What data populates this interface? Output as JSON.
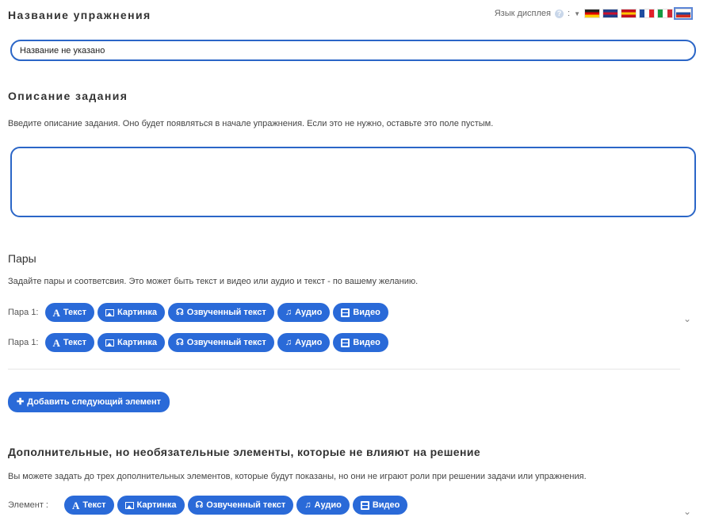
{
  "header": {
    "exercise_title_label": "Название упражнения",
    "display_language_label": "Язык дисплея",
    "help_glyph": "?",
    "separator": ":",
    "flags": [
      {
        "name": "flag-german",
        "stripes": [
          "#222222",
          "#dd0000",
          "#ffce00"
        ],
        "dir": "h"
      },
      {
        "name": "flag-uk",
        "stripes": [
          "#1f3f8a",
          "#c8102e",
          "#1f3f8a"
        ],
        "dir": "h"
      },
      {
        "name": "flag-spain",
        "stripes": [
          "#c60b1e",
          "#ffc400",
          "#c60b1e"
        ],
        "dir": "h"
      },
      {
        "name": "flag-france",
        "stripes": [
          "#1f4da0",
          "#ffffff",
          "#e1202a"
        ],
        "dir": "v"
      },
      {
        "name": "flag-italy",
        "stripes": [
          "#159a42",
          "#ffffff",
          "#cf2734"
        ],
        "dir": "v"
      },
      {
        "name": "flag-russia",
        "stripes": [
          "#ffffff",
          "#1f4da0",
          "#d52b1e"
        ],
        "dir": "h"
      }
    ]
  },
  "title_input": {
    "value": "Название не указано"
  },
  "description": {
    "heading": "Описание задания",
    "hint": "Введите описание задания. Оно будет появляться в начале упражнения. Если это не нужно, оставьте это поле пустым.",
    "value": ""
  },
  "pairs": {
    "heading": "Пары",
    "hint": "Задайте пары и соответсвия. Это может быть текст и видео или аудио и текст - по вашему желанию.",
    "rows": [
      {
        "label": "Пара 1:"
      },
      {
        "label": "Пара 1:"
      }
    ],
    "add_button": "Добавить следующий элемент"
  },
  "type_buttons": {
    "text": "Текст",
    "image": "Картинка",
    "spoken_text": "Озвученный текст",
    "audio": "Аудио",
    "video": "Видео"
  },
  "extra": {
    "heading": "Дополнительные, но необязательные элементы, которые не влияют на решение",
    "hint": "Вы можете задать до трех дополнительных элементов, которые будут показаны, но они не играют роли при решении задачи или упражнения.",
    "row_label": "Элемент :"
  },
  "icons": {
    "caret": "▼",
    "chevron": "⌄",
    "headphones": "☊",
    "music": "♫",
    "plus": "✚",
    "text_a": "A"
  },
  "colors": {
    "accent": "#2a6ad8",
    "input_border": "#2b66c7"
  }
}
